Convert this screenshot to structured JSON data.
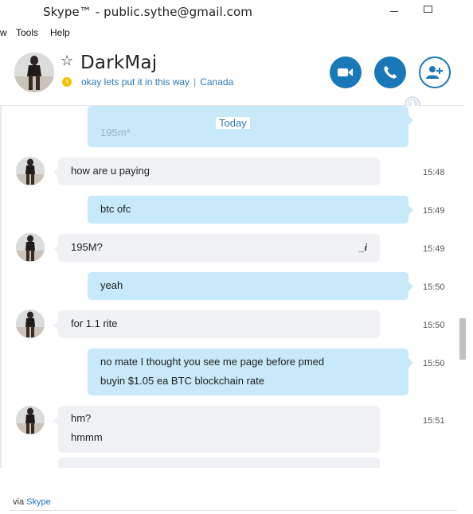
{
  "window": {
    "title": "Skype™ - public.sythe@gmail.com"
  },
  "menu": {
    "items": [
      "w",
      "Tools",
      "Help"
    ]
  },
  "contact": {
    "name": "DarkMaj",
    "mood": "okay lets put it in this way",
    "location": "Canada",
    "separator": "|"
  },
  "conversation": {
    "partial_top": "195m*",
    "divider": "Today",
    "messages": [
      {
        "dir": "in",
        "text": "how are u paying",
        "time": "15:48"
      },
      {
        "dir": "out",
        "text": "btc ofc",
        "time": "15:49"
      },
      {
        "dir": "in",
        "text": "195M?",
        "time": "15:49",
        "edited_icon": "_i"
      },
      {
        "dir": "out",
        "text": "yeah",
        "time": "15:50"
      },
      {
        "dir": "in",
        "text": "for 1.1 rite",
        "time": "15:50"
      },
      {
        "dir": "out",
        "lines": [
          "no mate I thought you see me page before pmed",
          "buyin $1.05 ea BTC blockchain rate"
        ],
        "time": "15:50"
      },
      {
        "dir": "in",
        "lines": [
          "hm?",
          "hmmm"
        ],
        "time": "15:51"
      }
    ]
  },
  "footer": {
    "via": "via",
    "via_link": "Skype"
  },
  "icons": {
    "minimize": "minimize-icon",
    "maximize": "maximize-icon",
    "star": "star-icon",
    "mood": "clock-icon",
    "video": "video-call-icon",
    "call": "phone-icon",
    "add": "add-contact-icon",
    "globe": "globe-icon"
  },
  "colors": {
    "accent": "#1a77b8",
    "incoming_bubble": "#eff1f4",
    "outgoing_bubble": "#c7e9fa",
    "mood_icon": "#f3c300"
  }
}
